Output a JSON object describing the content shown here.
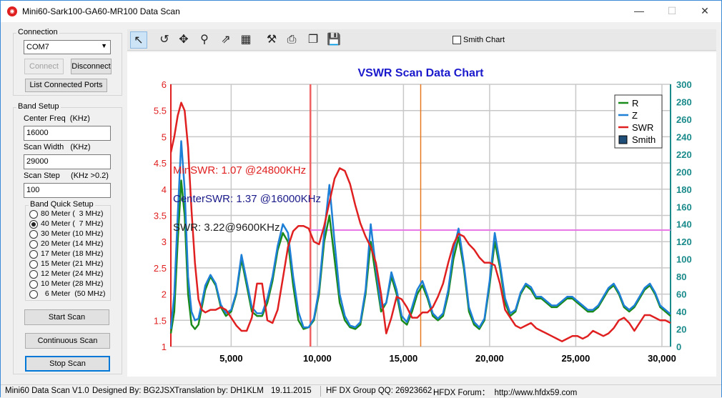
{
  "window": {
    "title": "Mini60-Sark100-GA60-MR100 Data Scan",
    "minimize": "—",
    "maximize": "☐",
    "close": "✕"
  },
  "connection": {
    "group_title": "Connection",
    "port_value": "COM7",
    "connect_label": "Connect",
    "disconnect_label": "Disconnect",
    "list_ports_label": "List Connected Ports"
  },
  "band_setup": {
    "group_title": "Band Setup",
    "center_freq_label": "Center Freq  (KHz)",
    "center_freq_value": "16000",
    "scan_width_label": "Scan Width   (KHz)",
    "scan_width_value": "29000",
    "scan_step_label": "Scan Step     (KHz >0.2)",
    "scan_step_value": "100",
    "quick_setup_title": "Band Quick Setup",
    "bands": [
      {
        "label": "80 Meter (  3 MHz)",
        "checked": false
      },
      {
        "label": "40 Meter (  7 MHz)",
        "checked": true
      },
      {
        "label": "30 Meter (10 MHz)",
        "checked": false
      },
      {
        "label": "20 Meter (14 MHz)",
        "checked": false
      },
      {
        "label": "17 Meter (18 MHz)",
        "checked": false
      },
      {
        "label": "15 Meter (21 MHz)",
        "checked": false
      },
      {
        "label": "12 Meter (24 MHz)",
        "checked": false
      },
      {
        "label": "10 Meter (28 MHz)",
        "checked": false
      },
      {
        "label": "  6 Meter  (50 MHz)",
        "checked": false
      }
    ]
  },
  "actions": {
    "start_scan": "Start Scan",
    "continuous_scan": "Continuous Scan",
    "stop_scan": "Stop Scan"
  },
  "toolbar": {
    "tools": [
      {
        "name": "pointer-icon",
        "glyph": "↖"
      },
      {
        "name": "undo-icon",
        "glyph": "↺"
      },
      {
        "name": "pan-icon",
        "glyph": "✥"
      },
      {
        "name": "zoom-icon",
        "glyph": "⚲"
      },
      {
        "name": "export-image-icon",
        "glyph": "⇗"
      },
      {
        "name": "data-grid-icon",
        "glyph": "▦"
      },
      {
        "name": "settings-tools-icon",
        "glyph": "⚒"
      },
      {
        "name": "print-icon",
        "glyph": "⎙"
      },
      {
        "name": "copy-icon",
        "glyph": "❐"
      },
      {
        "name": "save-icon",
        "glyph": "💾"
      }
    ],
    "smith_chart_label": "Smith Chart",
    "smith_chart_checked": false
  },
  "chart_data": {
    "type": "line",
    "title": "VSWR Scan Data Chart",
    "xlabel": "",
    "ylabel": "",
    "xlim": [
      1500,
      30500
    ],
    "ylim": [
      1,
      6
    ],
    "y2lim": [
      0,
      300
    ],
    "x_ticks": [
      "5,000",
      "10,000",
      "15,000",
      "20,000",
      "25,000",
      "30,000"
    ],
    "x_tick_values": [
      5000,
      10000,
      15000,
      20000,
      25000,
      30000
    ],
    "y_ticks": [
      "1",
      "1.5",
      "2",
      "2.5",
      "3",
      "3.5",
      "4",
      "4.5",
      "5",
      "5.5",
      "6"
    ],
    "y2_ticks": [
      "0",
      "20",
      "40",
      "60",
      "80",
      "100",
      "120",
      "140",
      "160",
      "180",
      "200",
      "220",
      "240",
      "260",
      "280",
      "300"
    ],
    "grid": true,
    "legend_position": "top-right",
    "legend": [
      "R",
      "Z",
      "SWR",
      "Smith"
    ],
    "colors": {
      "R": "#1a8a1a",
      "Z": "#1e7fd6",
      "SWR": "#e02020",
      "Smith": "#1f4e79",
      "swr_line": "#e878e8",
      "center_marker": "#e87820",
      "min_marker": "#f06060",
      "left_axis": "#e02020",
      "right_axis": "#1a8a8a",
      "title": "#1a1acc"
    },
    "annotations": {
      "min_swr": "MinSWR: 1.07 @24800KHz",
      "center_swr": "CenterSWR: 1.37 @16000KHz",
      "swr_at": "SWR: 3.22@9600KHz"
    },
    "markers": {
      "min_swr_x": 9600,
      "center_x": 16000,
      "swr_level": 3.22
    },
    "series": [
      {
        "name": "SWR",
        "axis": "left",
        "x": [
          1500,
          1700,
          1900,
          2100,
          2300,
          2500,
          2700,
          2900,
          3100,
          3300,
          3500,
          3800,
          4100,
          4400,
          4700,
          5000,
          5300,
          5600,
          5900,
          6200,
          6500,
          6800,
          7100,
          7400,
          7700,
          8000,
          8300,
          8600,
          8900,
          9200,
          9500,
          9800,
          10100,
          10400,
          10700,
          11000,
          11300,
          11600,
          11900,
          12200,
          12500,
          12800,
          13100,
          13400,
          13700,
          14000,
          14300,
          14600,
          14900,
          15200,
          15500,
          15800,
          16100,
          16400,
          16700,
          17000,
          17300,
          17600,
          17900,
          18200,
          18500,
          18800,
          19100,
          19400,
          19700,
          20000,
          20300,
          20600,
          20900,
          21200,
          21500,
          21800,
          22100,
          22400,
          22700,
          23000,
          23300,
          23600,
          23900,
          24200,
          24500,
          24800,
          25100,
          25400,
          25700,
          26000,
          26300,
          26600,
          26900,
          27200,
          27500,
          27800,
          28100,
          28400,
          28700,
          29000,
          29300,
          29600,
          29900,
          30200,
          30500
        ],
        "y": [
          4.7,
          5.0,
          5.4,
          5.65,
          5.5,
          4.8,
          3.6,
          2.6,
          1.9,
          1.7,
          1.65,
          1.7,
          1.7,
          1.75,
          1.7,
          1.55,
          1.4,
          1.3,
          1.3,
          1.55,
          2.2,
          2.2,
          1.5,
          1.45,
          1.7,
          2.3,
          2.9,
          3.2,
          3.3,
          3.3,
          3.25,
          3.0,
          2.95,
          3.3,
          3.75,
          4.2,
          4.4,
          4.35,
          4.1,
          3.7,
          3.35,
          3.1,
          2.9,
          2.6,
          2.0,
          1.25,
          1.55,
          1.95,
          1.9,
          1.75,
          1.55,
          1.55,
          1.65,
          1.65,
          1.75,
          1.95,
          2.2,
          2.6,
          2.95,
          3.15,
          3.1,
          2.95,
          2.85,
          2.7,
          2.6,
          2.6,
          2.55,
          2.2,
          1.7,
          1.55,
          1.4,
          1.35,
          1.4,
          1.45,
          1.35,
          1.3,
          1.25,
          1.2,
          1.15,
          1.1,
          1.15,
          1.2,
          1.2,
          1.15,
          1.2,
          1.3,
          1.25,
          1.2,
          1.25,
          1.35,
          1.5,
          1.55,
          1.45,
          1.3,
          1.45,
          1.6,
          1.6,
          1.55,
          1.5,
          1.5,
          1.45
        ]
      },
      {
        "name": "R",
        "axis": "right",
        "x": [
          1500,
          1700,
          1900,
          2100,
          2300,
          2500,
          2700,
          2900,
          3100,
          3300,
          3500,
          3800,
          4100,
          4400,
          4700,
          5000,
          5300,
          5600,
          5900,
          6200,
          6500,
          6800,
          7100,
          7400,
          7700,
          8000,
          8300,
          8600,
          8900,
          9200,
          9500,
          9800,
          10100,
          10400,
          10700,
          11000,
          11300,
          11600,
          11900,
          12200,
          12500,
          12800,
          13100,
          13400,
          13700,
          14000,
          14300,
          14600,
          14900,
          15200,
          15500,
          15800,
          16100,
          16400,
          16700,
          17000,
          17300,
          17600,
          17900,
          18200,
          18500,
          18800,
          19100,
          19400,
          19700,
          20000,
          20300,
          20600,
          20900,
          21200,
          21500,
          21800,
          22100,
          22400,
          22700,
          23000,
          23300,
          23600,
          23900,
          24200,
          24500,
          24800,
          25100,
          25400,
          25700,
          26000,
          26300,
          26600,
          26900,
          27200,
          27500,
          27800,
          28100,
          28400,
          28700,
          29000,
          29300,
          29600,
          29900,
          30200,
          30500
        ],
        "y": [
          15,
          40,
          120,
          190,
          150,
          60,
          25,
          20,
          25,
          45,
          65,
          80,
          70,
          45,
          35,
          40,
          60,
          100,
          70,
          40,
          35,
          35,
          50,
          75,
          110,
          130,
          120,
          70,
          30,
          20,
          22,
          30,
          60,
          120,
          150,
          100,
          50,
          30,
          22,
          20,
          25,
          60,
          120,
          80,
          40,
          50,
          80,
          60,
          30,
          25,
          40,
          60,
          70,
          55,
          35,
          30,
          35,
          60,
          100,
          125,
          90,
          40,
          25,
          20,
          30,
          70,
          120,
          90,
          50,
          35,
          40,
          60,
          70,
          65,
          55,
          55,
          50,
          45,
          45,
          50,
          55,
          55,
          50,
          45,
          40,
          40,
          45,
          55,
          65,
          70,
          60,
          45,
          40,
          45,
          55,
          65,
          70,
          60,
          45,
          40,
          35
        ]
      },
      {
        "name": "Z",
        "axis": "right",
        "x": [
          1500,
          1700,
          1900,
          2100,
          2300,
          2500,
          2700,
          2900,
          3100,
          3300,
          3500,
          3800,
          4100,
          4400,
          4700,
          5000,
          5300,
          5600,
          5900,
          6200,
          6500,
          6800,
          7100,
          7400,
          7700,
          8000,
          8300,
          8600,
          8900,
          9200,
          9500,
          9800,
          10100,
          10400,
          10700,
          11000,
          11300,
          11600,
          11900,
          12200,
          12500,
          12800,
          13100,
          13400,
          13700,
          14000,
          14300,
          14600,
          14900,
          15200,
          15500,
          15800,
          16100,
          16400,
          16700,
          17000,
          17300,
          17600,
          17900,
          18200,
          18500,
          18800,
          19100,
          19400,
          19700,
          20000,
          20300,
          20600,
          20900,
          21200,
          21500,
          21800,
          22100,
          22400,
          22700,
          23000,
          23300,
          23600,
          23900,
          24200,
          24500,
          24800,
          25100,
          25400,
          25700,
          26000,
          26300,
          26600,
          26900,
          27200,
          27500,
          27800,
          28100,
          28400,
          28700,
          29000,
          29300,
          29600,
          29900,
          30200,
          30500
        ],
        "y": [
          20,
          60,
          150,
          235,
          180,
          80,
          40,
          30,
          32,
          50,
          70,
          82,
          72,
          48,
          38,
          42,
          62,
          105,
          75,
          45,
          38,
          38,
          55,
          80,
          115,
          140,
          130,
          80,
          40,
          22,
          22,
          32,
          65,
          130,
          185,
          120,
          60,
          35,
          24,
          22,
          28,
          65,
          140,
          90,
          45,
          50,
          85,
          65,
          35,
          28,
          45,
          65,
          75,
          58,
          38,
          32,
          38,
          65,
          110,
          135,
          95,
          45,
          28,
          22,
          32,
          75,
          130,
          95,
          55,
          38,
          42,
          62,
          72,
          68,
          57,
          57,
          52,
          47,
          47,
          52,
          57,
          57,
          52,
          47,
          42,
          42,
          47,
          57,
          67,
          72,
          62,
          47,
          42,
          47,
          57,
          67,
          72,
          62,
          47,
          42,
          37
        ]
      }
    ]
  },
  "status": {
    "app": "Mini60 Data Scan V1.0",
    "designed": "Designed By: BG2JSX",
    "translation": "Translation by: DH1KLM",
    "date": "19.11.2015",
    "qq": "HF DX Group QQ: 26923662",
    "forum": "HFDX Forum：  http://www.hfdx59.com"
  }
}
